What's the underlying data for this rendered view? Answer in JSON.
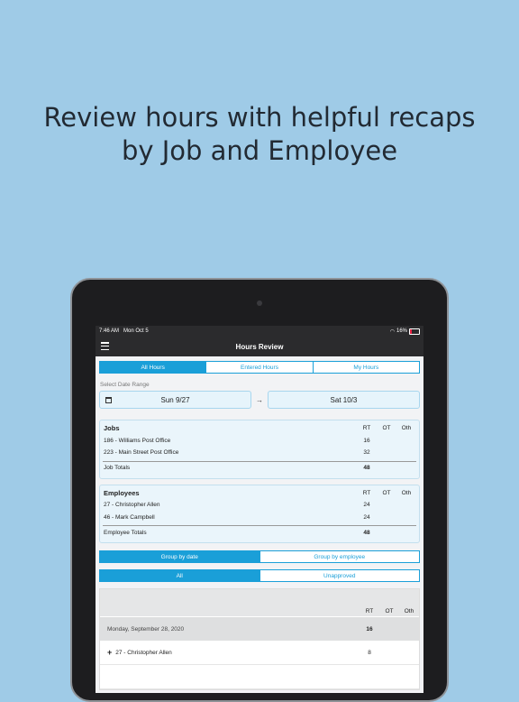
{
  "headline": {
    "line1": "Review hours with helpful recaps",
    "line2": "by Job and Employee"
  },
  "status_bar": {
    "time": "7:46 AM",
    "date": "Mon Oct 5",
    "battery": "16%"
  },
  "nav": {
    "title": "Hours Review"
  },
  "view_tabs": [
    {
      "label": "All Hours",
      "active": true
    },
    {
      "label": "Entered Hours",
      "active": false
    },
    {
      "label": "My Hours",
      "active": false
    }
  ],
  "date_range": {
    "label": "Select Date Range",
    "start": "Sun 9/27",
    "arrow": "→",
    "end": "Sat 10/3"
  },
  "jobs": {
    "title": "Jobs",
    "columns": [
      "RT",
      "OT",
      "Oth"
    ],
    "rows": [
      {
        "name": "186 - Williams Post Office",
        "rt": "16",
        "ot": "",
        "oth": ""
      },
      {
        "name": "223 - Main Street Post Office",
        "rt": "32",
        "ot": "",
        "oth": ""
      }
    ],
    "total_label": "Job Totals",
    "total_rt": "48"
  },
  "employees": {
    "title": "Employees",
    "columns": [
      "RT",
      "OT",
      "Oth"
    ],
    "rows": [
      {
        "name": "27 - Christopher Allen",
        "rt": "24",
        "ot": "",
        "oth": ""
      },
      {
        "name": "46 - Mark Campbell",
        "rt": "24",
        "ot": "",
        "oth": ""
      }
    ],
    "total_label": "Employee Totals",
    "total_rt": "48"
  },
  "group_tabs": [
    {
      "label": "Group by date",
      "active": true
    },
    {
      "label": "Group by employee",
      "active": false
    }
  ],
  "filter_tabs": [
    {
      "label": "All",
      "active": true
    },
    {
      "label": "Unapproved",
      "active": false
    }
  ],
  "detail_table": {
    "columns": [
      "RT",
      "OT",
      "Oth"
    ],
    "day": {
      "label": "Monday, September 28, 2020",
      "rt": "16"
    },
    "entry": {
      "expand": "+",
      "name": "27 - Christopher Allen",
      "rt": "8"
    }
  },
  "colors": {
    "background": "#9fcbe7",
    "accent": "#1a9fd8",
    "navbar": "#2b2b2d"
  }
}
